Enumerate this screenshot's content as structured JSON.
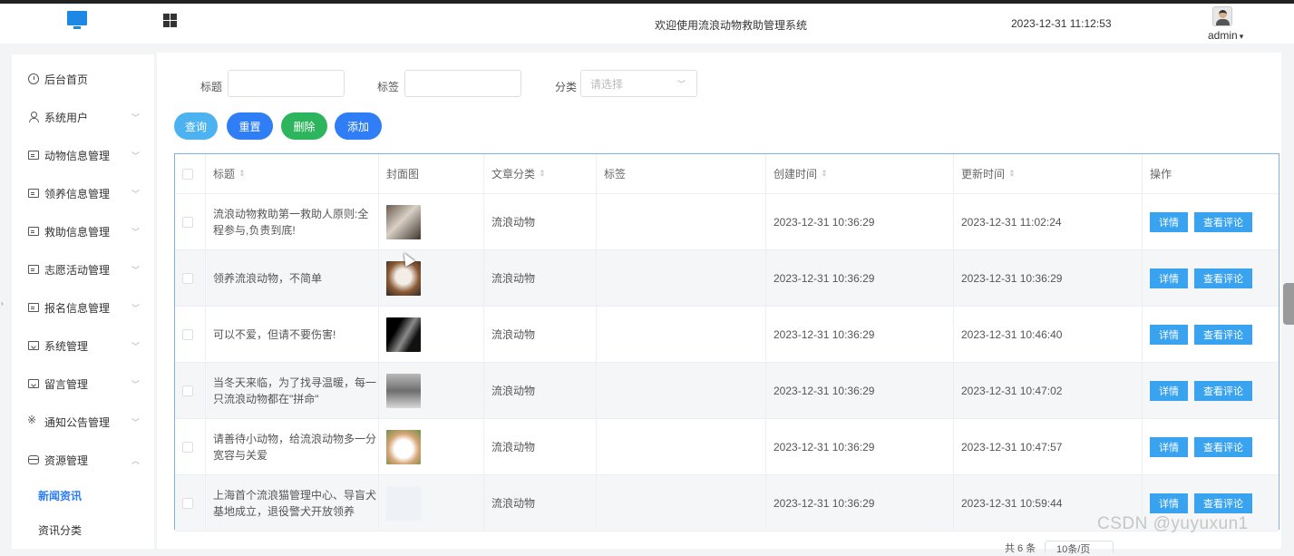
{
  "header": {
    "system_title": "欢迎使用流浪动物救助管理系统",
    "datetime": "2023-12-31 11:12:53",
    "username": "admin",
    "brand_color": "#1e88e5"
  },
  "sidebar": {
    "items": [
      {
        "label": "后台首页",
        "icon": "clock-icon",
        "chevron": ""
      },
      {
        "label": "系统用户",
        "icon": "user-icon",
        "chevron": "﹀"
      },
      {
        "label": "动物信息管理",
        "icon": "card-icon",
        "chevron": "﹀"
      },
      {
        "label": "领养信息管理",
        "icon": "card-icon",
        "chevron": "﹀"
      },
      {
        "label": "救助信息管理",
        "icon": "card-icon",
        "chevron": "﹀"
      },
      {
        "label": "志愿活动管理",
        "icon": "card-icon",
        "chevron": "﹀"
      },
      {
        "label": "报名信息管理",
        "icon": "card-icon",
        "chevron": "﹀"
      },
      {
        "label": "系统管理",
        "icon": "folder-icon",
        "chevron": "﹀"
      },
      {
        "label": "留言管理",
        "icon": "folder-icon",
        "chevron": "﹀"
      },
      {
        "label": "通知公告管理",
        "icon": "sun-icon",
        "chevron": "﹀"
      },
      {
        "label": "资源管理",
        "icon": "box-icon",
        "chevron": "︿"
      }
    ],
    "sub_items": [
      {
        "label": "新闻资讯",
        "active": true
      },
      {
        "label": "资讯分类",
        "active": false
      }
    ]
  },
  "filters": {
    "title_label": "标题",
    "tag_label": "标签",
    "category_label": "分类",
    "category_placeholder": "请选择"
  },
  "buttons": {
    "query": "查询",
    "reset": "重置",
    "delete": "删除",
    "add": "添加",
    "query_color": "#4db3f0",
    "reset_color": "#2f7ef5",
    "delete_color": "#2db55d",
    "add_color": "#2f7ef5"
  },
  "table": {
    "columns": [
      "标题",
      "封面图",
      "文章分类",
      "标签",
      "创建时间",
      "更新时间",
      "操作"
    ],
    "sort_glyph": "⇕",
    "rows": [
      {
        "title": "流浪动物救助第一救助人原则:全程参与,负责到底!",
        "category": "流浪动物",
        "tag": "",
        "created": "2023-12-31 10:36:29",
        "updated": "2023-12-31 11:02:24"
      },
      {
        "title": "领养流浪动物，不简单",
        "category": "流浪动物",
        "tag": "",
        "created": "2023-12-31 10:36:29",
        "updated": "2023-12-31 10:36:29"
      },
      {
        "title": "可以不爱，但请不要伤害!",
        "category": "流浪动物",
        "tag": "",
        "created": "2023-12-31 10:36:29",
        "updated": "2023-12-31 10:46:40"
      },
      {
        "title": "当冬天来临，为了找寻温暖，每一只流浪动物都在\"拼命\"",
        "category": "流浪动物",
        "tag": "",
        "created": "2023-12-31 10:36:29",
        "updated": "2023-12-31 10:47:02"
      },
      {
        "title": "请善待小动物，给流浪动物多一分宽容与关爱",
        "category": "流浪动物",
        "tag": "",
        "created": "2023-12-31 10:36:29",
        "updated": "2023-12-31 10:47:57"
      },
      {
        "title": "上海首个流浪猫管理中心、导盲犬基地成立，退役警犬开放领养",
        "category": "流浪动物",
        "tag": "",
        "created": "2023-12-31 10:36:29",
        "updated": "2023-12-31 10:59:44"
      }
    ],
    "detail_label": "详情",
    "comments_label": "查看评论"
  },
  "pagination": {
    "total_text": "共 6 条",
    "page_size_text": "10条/页"
  },
  "watermark": "CSDN @yuyuxun1"
}
